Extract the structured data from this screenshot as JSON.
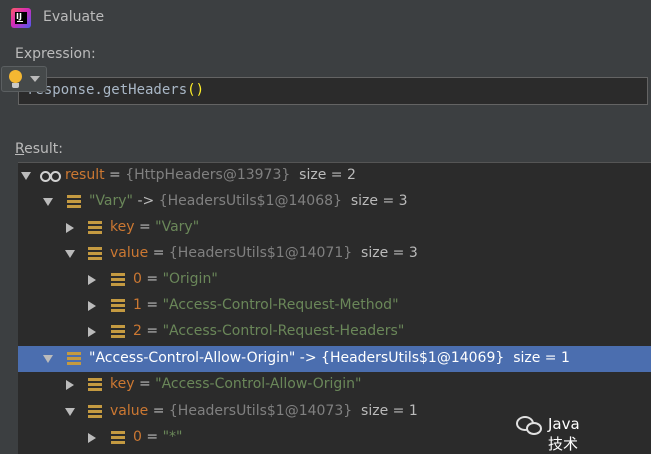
{
  "window": {
    "title": "Evaluate",
    "app_icon": "intellij-idea-icon",
    "app_icon_letters": "IJ"
  },
  "expression": {
    "label": "Expression:",
    "code": "response.getHeaders",
    "parens": "()"
  },
  "result": {
    "label_first": "R",
    "label_rest": "esult:",
    "rows": [
      {
        "name": "result",
        "eq": " = ",
        "value": "{HttpHeaders@13973}",
        "size": "size = 2"
      },
      {
        "name": "\"Vary\"",
        "eq": " -> ",
        "value": "{HeadersUtils$1@14068}",
        "size": "size = 3"
      },
      {
        "name": "key",
        "eq": " = ",
        "value": "\"Vary\""
      },
      {
        "name": "value",
        "eq": " = ",
        "value": "{HeadersUtils$1@14071}",
        "size": "size = 3"
      },
      {
        "name": "0",
        "eq": " = ",
        "value": "\"Origin\""
      },
      {
        "name": "1",
        "eq": " = ",
        "value": "\"Access-Control-Request-Method\""
      },
      {
        "name": "2",
        "eq": " = ",
        "value": "\"Access-Control-Request-Headers\""
      },
      {
        "name": "\"Access-Control-Allow-Origin\"",
        "eq": " -> ",
        "value": "{HeadersUtils$1@14069}",
        "size": "size = 1"
      },
      {
        "name": "key",
        "eq": " = ",
        "value": "\"Access-Control-Allow-Origin\""
      },
      {
        "name": "value",
        "eq": " = ",
        "value": "{HeadersUtils$1@14073}",
        "size": "size = 1"
      },
      {
        "name": "0",
        "eq": " = ",
        "value": "\"*\""
      }
    ]
  },
  "watermark": {
    "text": "Java技术栈",
    "icon": "wechat-icon"
  },
  "colors": {
    "background": "#3c3f41",
    "tree_background": "#2b2b2b",
    "selection": "#4b6eaf",
    "field_name": "#cc7832",
    "string_value": "#6a8759",
    "reference": "#808080"
  }
}
